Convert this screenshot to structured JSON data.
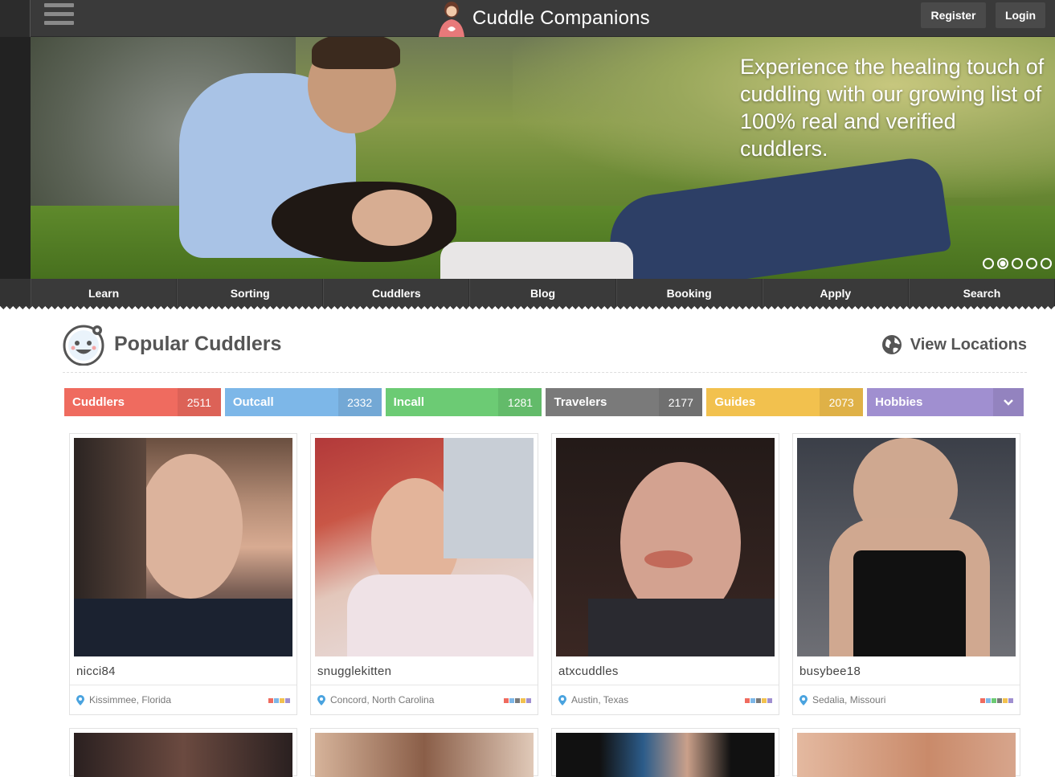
{
  "header": {
    "brand_name": "Cuddle Companions",
    "register_label": "Register",
    "login_label": "Login"
  },
  "hero": {
    "tagline": "Experience the healing touch of cuddling with our growing list of 100% real and verified cuddlers.",
    "slides": 5,
    "active_slide": 2
  },
  "nav": {
    "items": [
      "Learn",
      "Sorting",
      "Cuddlers",
      "Blog",
      "Booking",
      "Apply",
      "Search"
    ]
  },
  "section": {
    "title": "Popular Cuddlers",
    "view_locations_label": "View Locations"
  },
  "filters": [
    {
      "label": "Cuddlers",
      "count": "2511",
      "color": "#ef6b5f"
    },
    {
      "label": "Outcall",
      "count": "2332",
      "color": "#7db7e8"
    },
    {
      "label": "Incall",
      "count": "1281",
      "color": "#6ccb74"
    },
    {
      "label": "Travelers",
      "count": "2177",
      "color": "#7a7a7a"
    },
    {
      "label": "Guides",
      "count": "2073",
      "color": "#f2c14e"
    },
    {
      "label": "Hobbies",
      "count": "",
      "color": "#a08fd0"
    }
  ],
  "cuddlers": [
    {
      "username": "nicci84",
      "location": "Kissimmee, Florida",
      "swatches": [
        "#ef6b5f",
        "#7db7e8",
        "#f2c14e",
        "#a08fd0"
      ]
    },
    {
      "username": "snugglekitten",
      "location": "Concord, North Carolina",
      "swatches": [
        "#ef6b5f",
        "#7db7e8",
        "#7a7a7a",
        "#f2c14e",
        "#a08fd0"
      ]
    },
    {
      "username": "atxcuddles",
      "location": "Austin, Texas",
      "swatches": [
        "#ef6b5f",
        "#7db7e8",
        "#7a7a7a",
        "#f2c14e",
        "#a08fd0"
      ]
    },
    {
      "username": "busybee18",
      "location": "Sedalia, Missouri",
      "swatches": [
        "#ef6b5f",
        "#7db7e8",
        "#6ccb74",
        "#7a7a7a",
        "#f2c14e",
        "#a08fd0"
      ]
    }
  ]
}
